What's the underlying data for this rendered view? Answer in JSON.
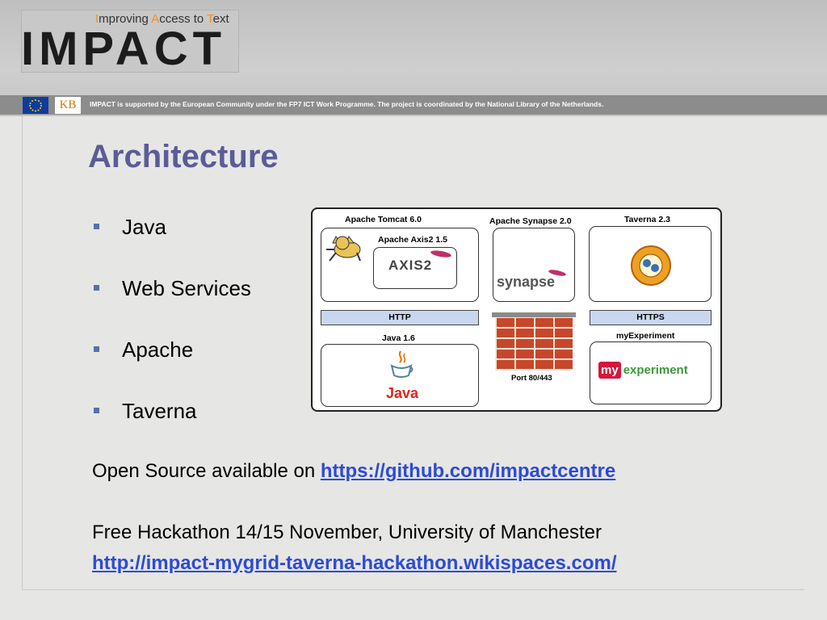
{
  "header": {
    "tagline": {
      "i_cap": "I",
      "i_rest": "mproving ",
      "a_cap": "A",
      "a_rest": "ccess to ",
      "t_cap": "T",
      "t_rest": "ext"
    },
    "logo_word": "IMPACT",
    "support_text": "IMPACT is supported by the European Community under the FP7 ICT Work Programme. The project is coordinated by the National Library of the Netherlands.",
    "kb_text": "KB"
  },
  "title": "Architecture",
  "bullets": [
    "Java",
    "Web Services",
    "Apache",
    "Taverna"
  ],
  "open_source": {
    "prefix": "Open Source available on ",
    "link": "https://github.com/impactcentre"
  },
  "hackathon": {
    "text": "Free Hackathon 14/15 November, University of Manchester",
    "link": "http://impact-mygrid-taverna-hackathon.wikispaces.com/"
  },
  "diagram": {
    "tomcat": "Apache Tomcat 6.0",
    "axis2": "Apache Axis2 1.5",
    "axis2_logo": "AXIS2",
    "synapse": "Apache Synapse 2.0",
    "synapse_logo": "synapse",
    "taverna": "Taverna 2.3",
    "http": "HTTP",
    "https": "HTTPS",
    "java": "Java 1.6",
    "java_logo": "Java",
    "port": "Port 80/443",
    "myexperiment": "myExperiment",
    "my_logo_my": "my",
    "my_logo_exp": "experiment"
  }
}
